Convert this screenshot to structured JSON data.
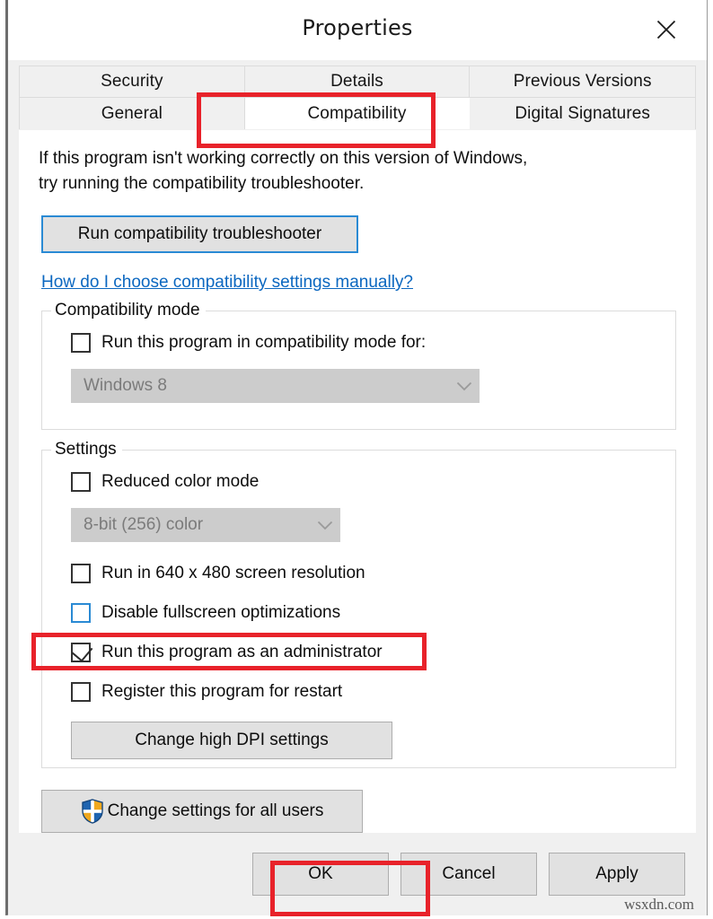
{
  "window": {
    "title": "Properties",
    "close_icon": "close-icon"
  },
  "tabs": {
    "row1": [
      {
        "label": "Security",
        "selected": false
      },
      {
        "label": "Details",
        "selected": false
      },
      {
        "label": "Previous Versions",
        "selected": false
      }
    ],
    "row2": [
      {
        "label": "General",
        "selected": false
      },
      {
        "label": "Compatibility",
        "selected": true
      },
      {
        "label": "Digital Signatures",
        "selected": false
      }
    ]
  },
  "page": {
    "intro": "If this program isn't working correctly on this version of Windows,\ntry running the compatibility troubleshooter.",
    "troubleshoot_button": "Run compatibility troubleshooter",
    "help_link": "How do I choose compatibility settings manually?",
    "compatibility_mode": {
      "title": "Compatibility mode",
      "checkbox_label": "Run this program in compatibility mode for:",
      "checkbox_checked": "",
      "os_select_value": "Windows 8",
      "chevron_icon": "chevron-down-icon"
    },
    "settings": {
      "title": "Settings",
      "reduced_color_label": "Reduced color mode",
      "color_depth_value": "8-bit (256) color",
      "chevron_icon": "chevron-down-icon",
      "resolution_label": "Run in 640 x 480 screen resolution",
      "fullscreen_label": "Disable fullscreen optimizations",
      "administrator_label": "Run this program as an administrator",
      "register_restart_label": "Register this program for restart",
      "dpi_button": "Change high DPI settings"
    },
    "all_users_button": "Change settings for all users",
    "shield_icon": "uac-shield-icon"
  },
  "footer": {
    "ok": "OK",
    "cancel": "Cancel",
    "apply": "Apply",
    "watermark": "wsxdn.com"
  },
  "colors": {
    "accent_blue": "#2a8ad4",
    "link_blue": "#0b67c0",
    "highlight_red": "#e8222a",
    "shield_blue": "#1f64b0",
    "shield_gold": "#f0a81e"
  }
}
